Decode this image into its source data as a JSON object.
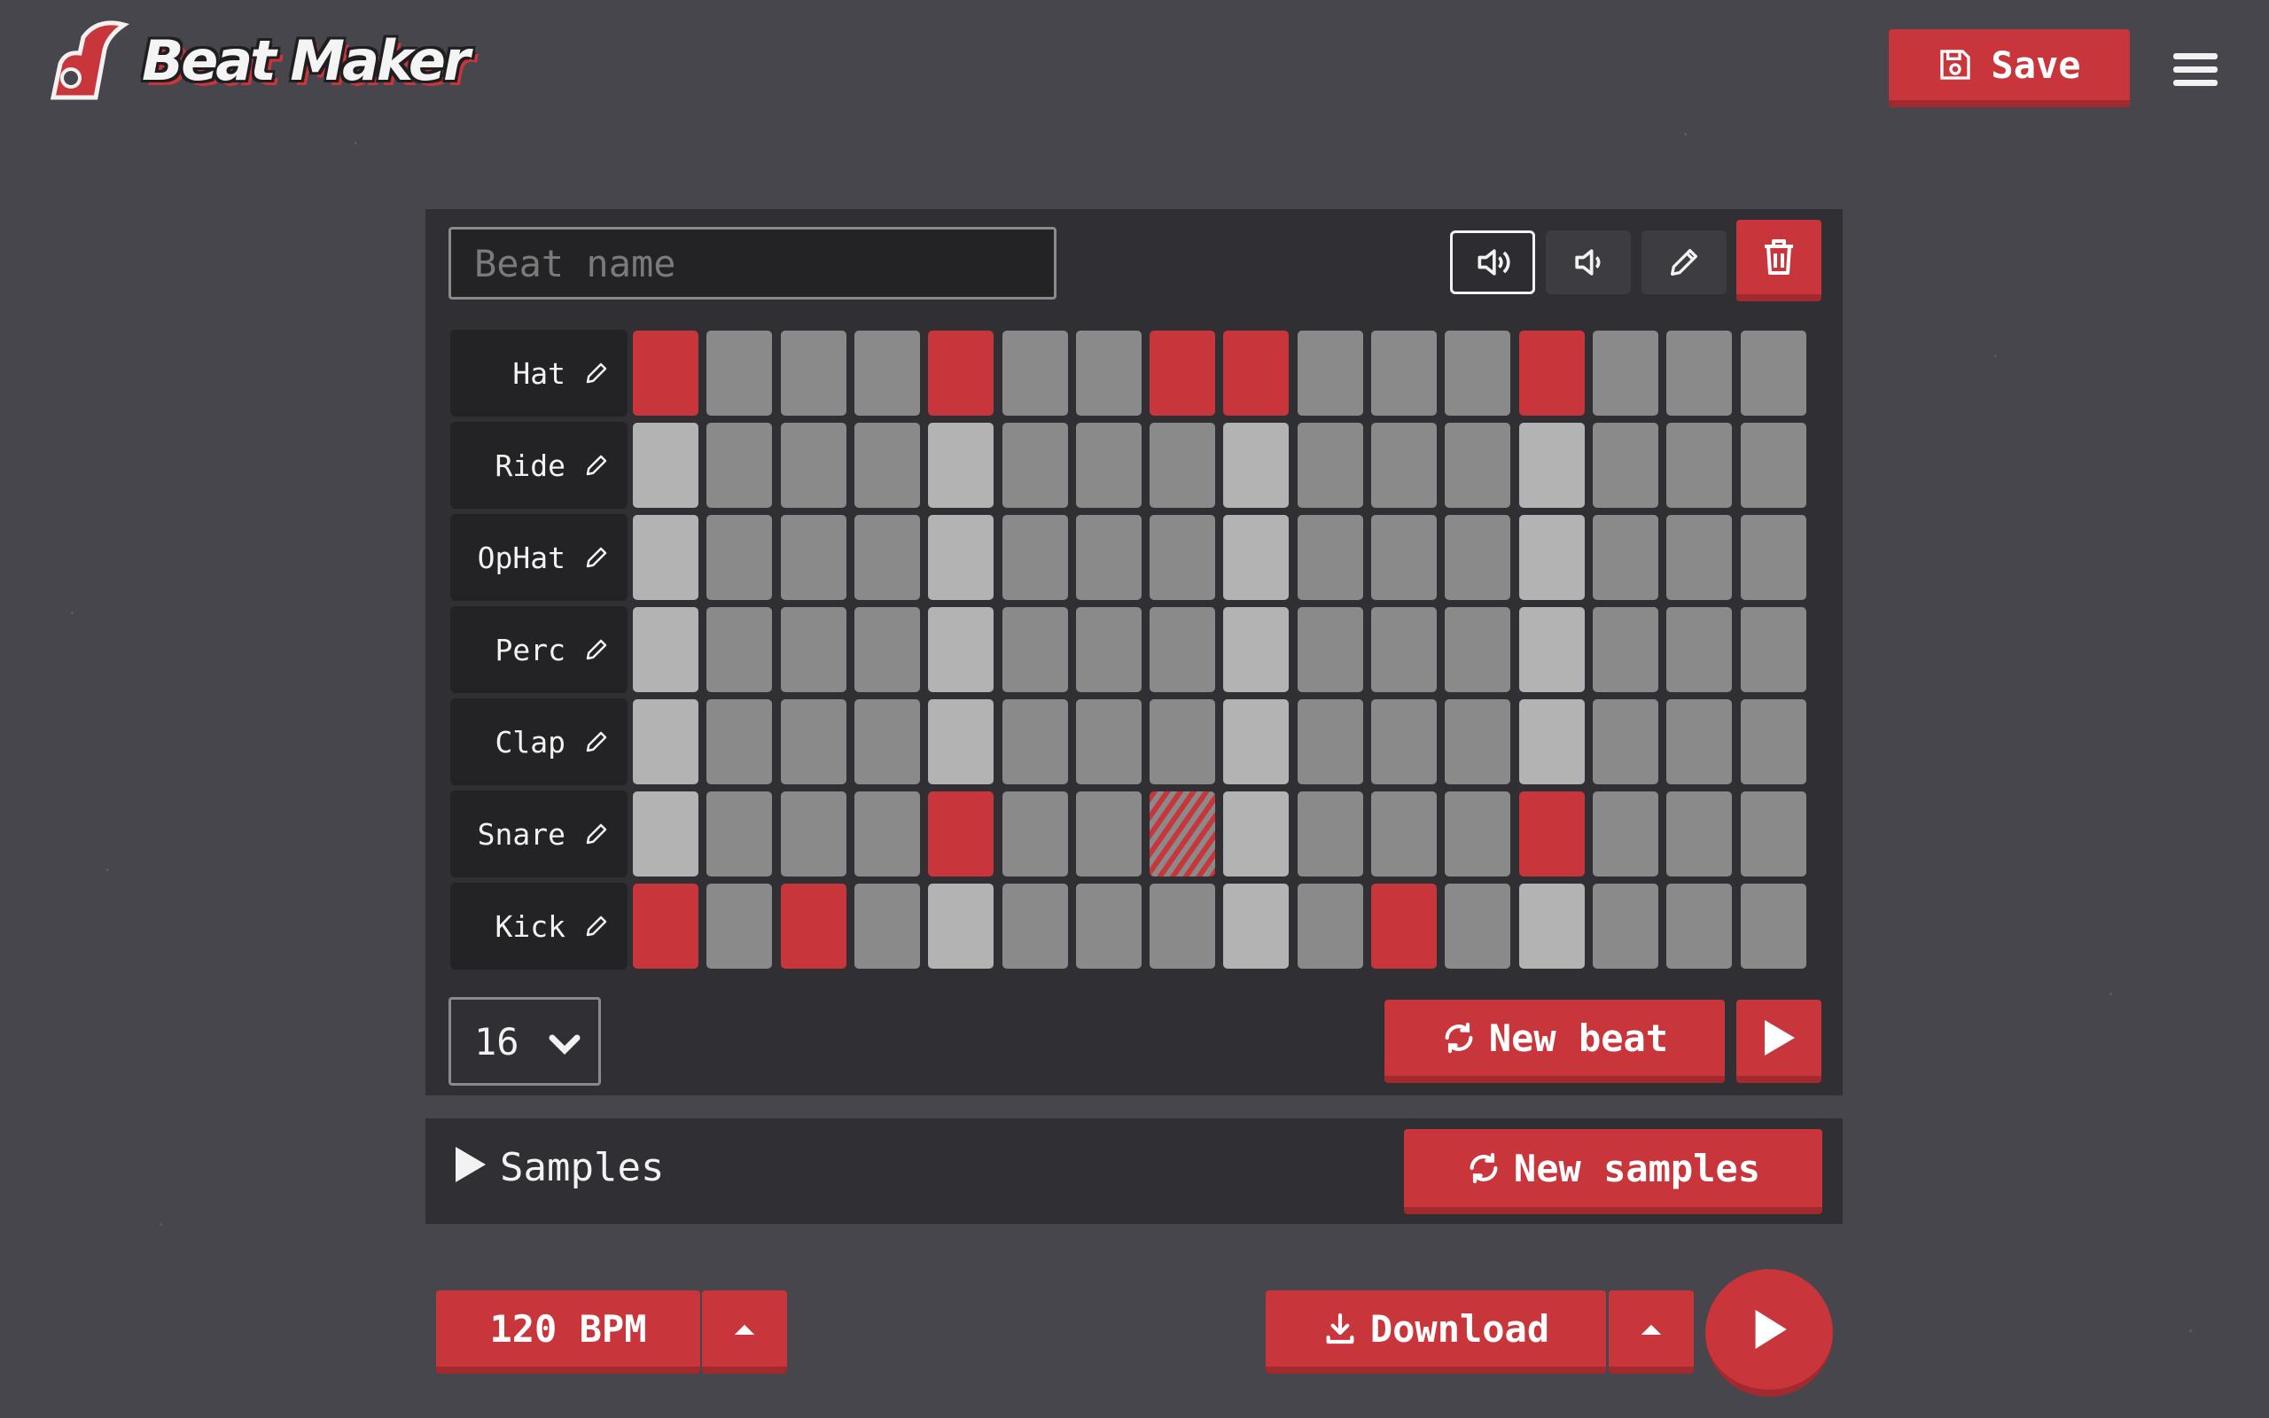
{
  "app": {
    "title": "Beat Maker"
  },
  "header": {
    "save_label": "Save",
    "menu_icon": "hamburger-icon"
  },
  "editor": {
    "beat_name_placeholder": "Beat name",
    "beat_name_value": "",
    "toolbar": {
      "volume_loud_icon": "volume-loud-icon",
      "volume_soft_icon": "volume-soft-icon",
      "edit_icon": "pencil-icon",
      "delete_icon": "trash-icon"
    },
    "tracks": [
      {
        "name": "Hat",
        "steps": [
          1,
          0,
          0,
          0,
          1,
          0,
          0,
          1,
          1,
          0,
          0,
          0,
          1,
          0,
          0,
          0
        ]
      },
      {
        "name": "Ride",
        "steps": [
          0,
          0,
          0,
          0,
          0,
          0,
          0,
          0,
          0,
          0,
          0,
          0,
          0,
          0,
          0,
          0
        ]
      },
      {
        "name": "OpHat",
        "steps": [
          0,
          0,
          0,
          0,
          0,
          0,
          0,
          0,
          0,
          0,
          0,
          0,
          0,
          0,
          0,
          0
        ]
      },
      {
        "name": "Perc",
        "steps": [
          0,
          0,
          0,
          0,
          0,
          0,
          0,
          0,
          0,
          0,
          0,
          0,
          0,
          0,
          0,
          0
        ]
      },
      {
        "name": "Clap",
        "steps": [
          0,
          0,
          0,
          0,
          0,
          0,
          0,
          0,
          0,
          0,
          0,
          0,
          0,
          0,
          0,
          0
        ]
      },
      {
        "name": "Snare",
        "steps": [
          0,
          0,
          0,
          0,
          1,
          0,
          0,
          0,
          0,
          0,
          0,
          0,
          1,
          0,
          0,
          0
        ],
        "hatched_step": 7
      },
      {
        "name": "Kick",
        "steps": [
          1,
          0,
          1,
          0,
          0,
          0,
          0,
          0,
          0,
          0,
          1,
          0,
          0,
          0,
          0,
          0
        ]
      }
    ],
    "step_count": "16",
    "new_beat_label": "New beat"
  },
  "samples": {
    "label": "Samples",
    "new_samples_label": "New samples"
  },
  "footer": {
    "bpm_label": "120 BPM",
    "download_label": "Download"
  },
  "colors": {
    "background": "#47464d",
    "panel": "#303034",
    "accent": "#c8363b",
    "cell_off": "#8a8a8a",
    "cell_beat": "#b3b3b3"
  }
}
